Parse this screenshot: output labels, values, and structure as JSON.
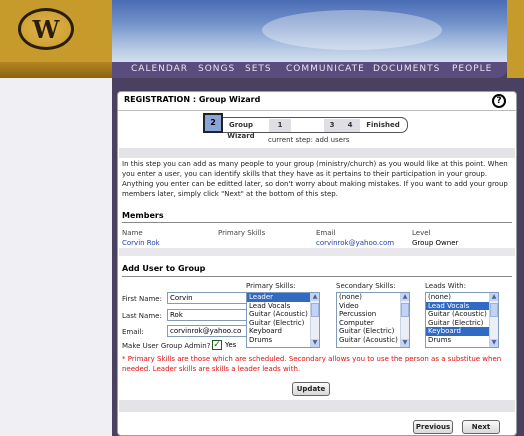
{
  "nav": {
    "items": [
      "CALENDAR",
      "SONGS",
      "SETS",
      "COMMUNICATE",
      "DOCUMENTS",
      "PEOPLE"
    ]
  },
  "panel": {
    "title": "REGISTRATION : Group Wizard",
    "help_label": "?"
  },
  "wizard": {
    "steps": [
      "Group Wizard",
      "1",
      "2",
      "3",
      "4",
      "Finished"
    ],
    "current_step_text": "current step: add users"
  },
  "intro": {
    "text": "In this step you can add as many people to your group (ministry/church) as you would like at this point. When you enter a user, you can identify skills that they have as it pertains to their participation in your group. Anything you enter can be editted later, so don't worry about making mistakes. If you want to add your group members later, simply click \"Next\" at the bottom of this step."
  },
  "members": {
    "title": "Members",
    "columns": [
      "Name",
      "Primary Skills",
      "Email",
      "Level"
    ],
    "rows": [
      {
        "name": "Corvin Rok",
        "primary_skills": "",
        "email": "corvinrok@yahoo.com",
        "level": "Group Owner"
      }
    ]
  },
  "add_user": {
    "title": "Add User to Group",
    "first_name_label": "First Name:",
    "first_name_value": "Corvin",
    "last_name_label": "Last Name:",
    "last_name_value": "Rok",
    "email_label": "Email:",
    "email_value": "corvinrok@yahoo.co",
    "admin_label": "Make User Group Admin?",
    "admin_checked": true,
    "admin_yes": "Yes",
    "primary_label": "Primary Skills:",
    "primary_options": [
      "Leader",
      "Lead Vocals",
      "Guitar (Acoustic)",
      "Guitar (Electric)",
      "Keyboard",
      "Drums"
    ],
    "primary_selected": 0,
    "secondary_label": "Secondary Skills:",
    "secondary_options": [
      "(none)",
      "Video",
      "Percussion",
      "Computer",
      "Guitar (Electric)",
      "Guitar (Acoustic)"
    ],
    "secondary_selected": -1,
    "leads_label": "Leads With:",
    "leads_options": [
      "(none)",
      "Lead Vocals",
      "Guitar (Acoustic)",
      "Guitar (Electric)",
      "Keyboard",
      "Drums"
    ],
    "leads_selected": [
      1,
      4
    ],
    "note": "* Primary Skills are those which are scheduled. Secondary allows you to use the person as a substitue when needed. Leader skills are skills a leader leads with.",
    "update_label": "Update"
  },
  "footer": {
    "previous_label": "Previous",
    "next_label": "Next"
  },
  "colors": {
    "nav_bg": "#5a4c7c",
    "logo_gold": "#c79a2c",
    "link_blue": "#1c3fb0",
    "note_red": "#e01010",
    "selection_blue": "#316ac5"
  }
}
